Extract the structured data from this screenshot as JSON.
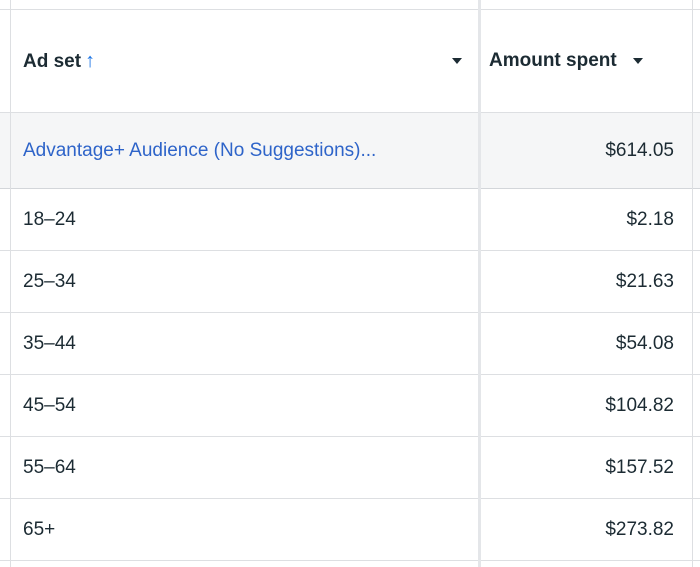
{
  "header": {
    "adset_label": "Ad set",
    "sort_arrow": "↑",
    "amount_label": "Amount spent"
  },
  "summary": {
    "adset": "Advantage+ Audience (No Suggestions)...",
    "amount": "$614.05"
  },
  "rows": [
    {
      "adset": "18–24",
      "amount": "$2.18"
    },
    {
      "adset": "25–34",
      "amount": "$21.63"
    },
    {
      "adset": "35–44",
      "amount": "$54.08"
    },
    {
      "adset": "45–54",
      "amount": "$104.82"
    },
    {
      "adset": "55–64",
      "amount": "$157.52"
    },
    {
      "adset": "65+",
      "amount": "$273.82"
    }
  ],
  "colors": {
    "link": "#2e64c9",
    "sort_arrow": "#1b74e4",
    "text": "#1c2b33",
    "border": "#dddfe2"
  }
}
